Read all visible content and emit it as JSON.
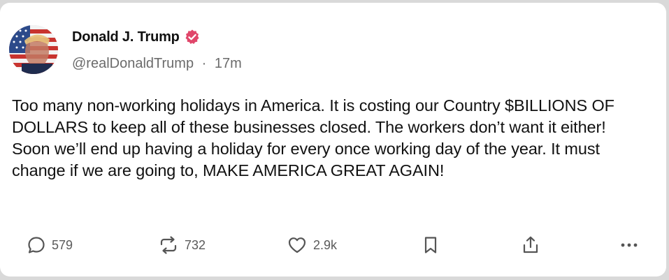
{
  "post": {
    "author_name": "Donald J. Trump",
    "handle": "@realDonaldTrump",
    "separator": "·",
    "time": "17m",
    "body": "Too many non-working holidays in America. It is costing our Country $BILLIONS OF DOLLARS to keep all of these businesses closed. The workers don’t want it either! Soon we’ll end up having a holiday for every once working day of the year. It must change if we are going to, MAKE AMERICA GREAT AGAIN!",
    "verified_icon": "verified-badge-icon",
    "verified_color": "#e0466a"
  },
  "actions": {
    "replies": {
      "icon": "comment-icon",
      "count": "579"
    },
    "reposts": {
      "icon": "repost-icon",
      "count": "732"
    },
    "likes": {
      "icon": "heart-icon",
      "count": "2.9k"
    },
    "bookmark": {
      "icon": "bookmark-icon"
    },
    "share": {
      "icon": "share-icon"
    },
    "more": {
      "icon": "more-icon"
    }
  }
}
